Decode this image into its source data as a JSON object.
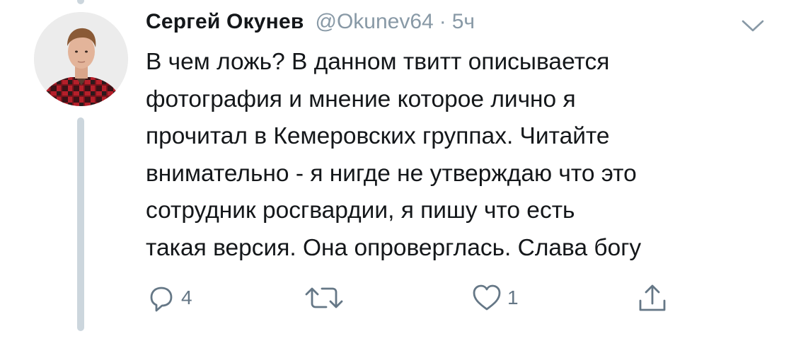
{
  "tweet": {
    "author": {
      "name": "Сергей Окунев",
      "handle": "@Okunev64"
    },
    "separator": "·",
    "timestamp": "5ч",
    "text_lines": [
      "В чем ложь? В данном твитт описывается",
      "фотография и мнение которое лично я",
      "прочитал в Кемеровских группах. Читайте",
      "внимательно - я нигде не утверждаю что это",
      "сотрудник росгвардии, я пишу что есть",
      "такая версия. Она опроверглась. Слава богу"
    ],
    "actions": {
      "reply_count": "4",
      "retweet_count": "",
      "like_count": "1"
    }
  },
  "icons": {
    "more": "chevron-down-icon",
    "reply": "reply-icon",
    "retweet": "retweet-icon",
    "like": "heart-icon",
    "share": "share-icon"
  },
  "colors": {
    "text_primary": "#14171a",
    "text_secondary": "#8899a6",
    "icon_gray": "#657786",
    "thread_line": "#ccd6dd"
  }
}
